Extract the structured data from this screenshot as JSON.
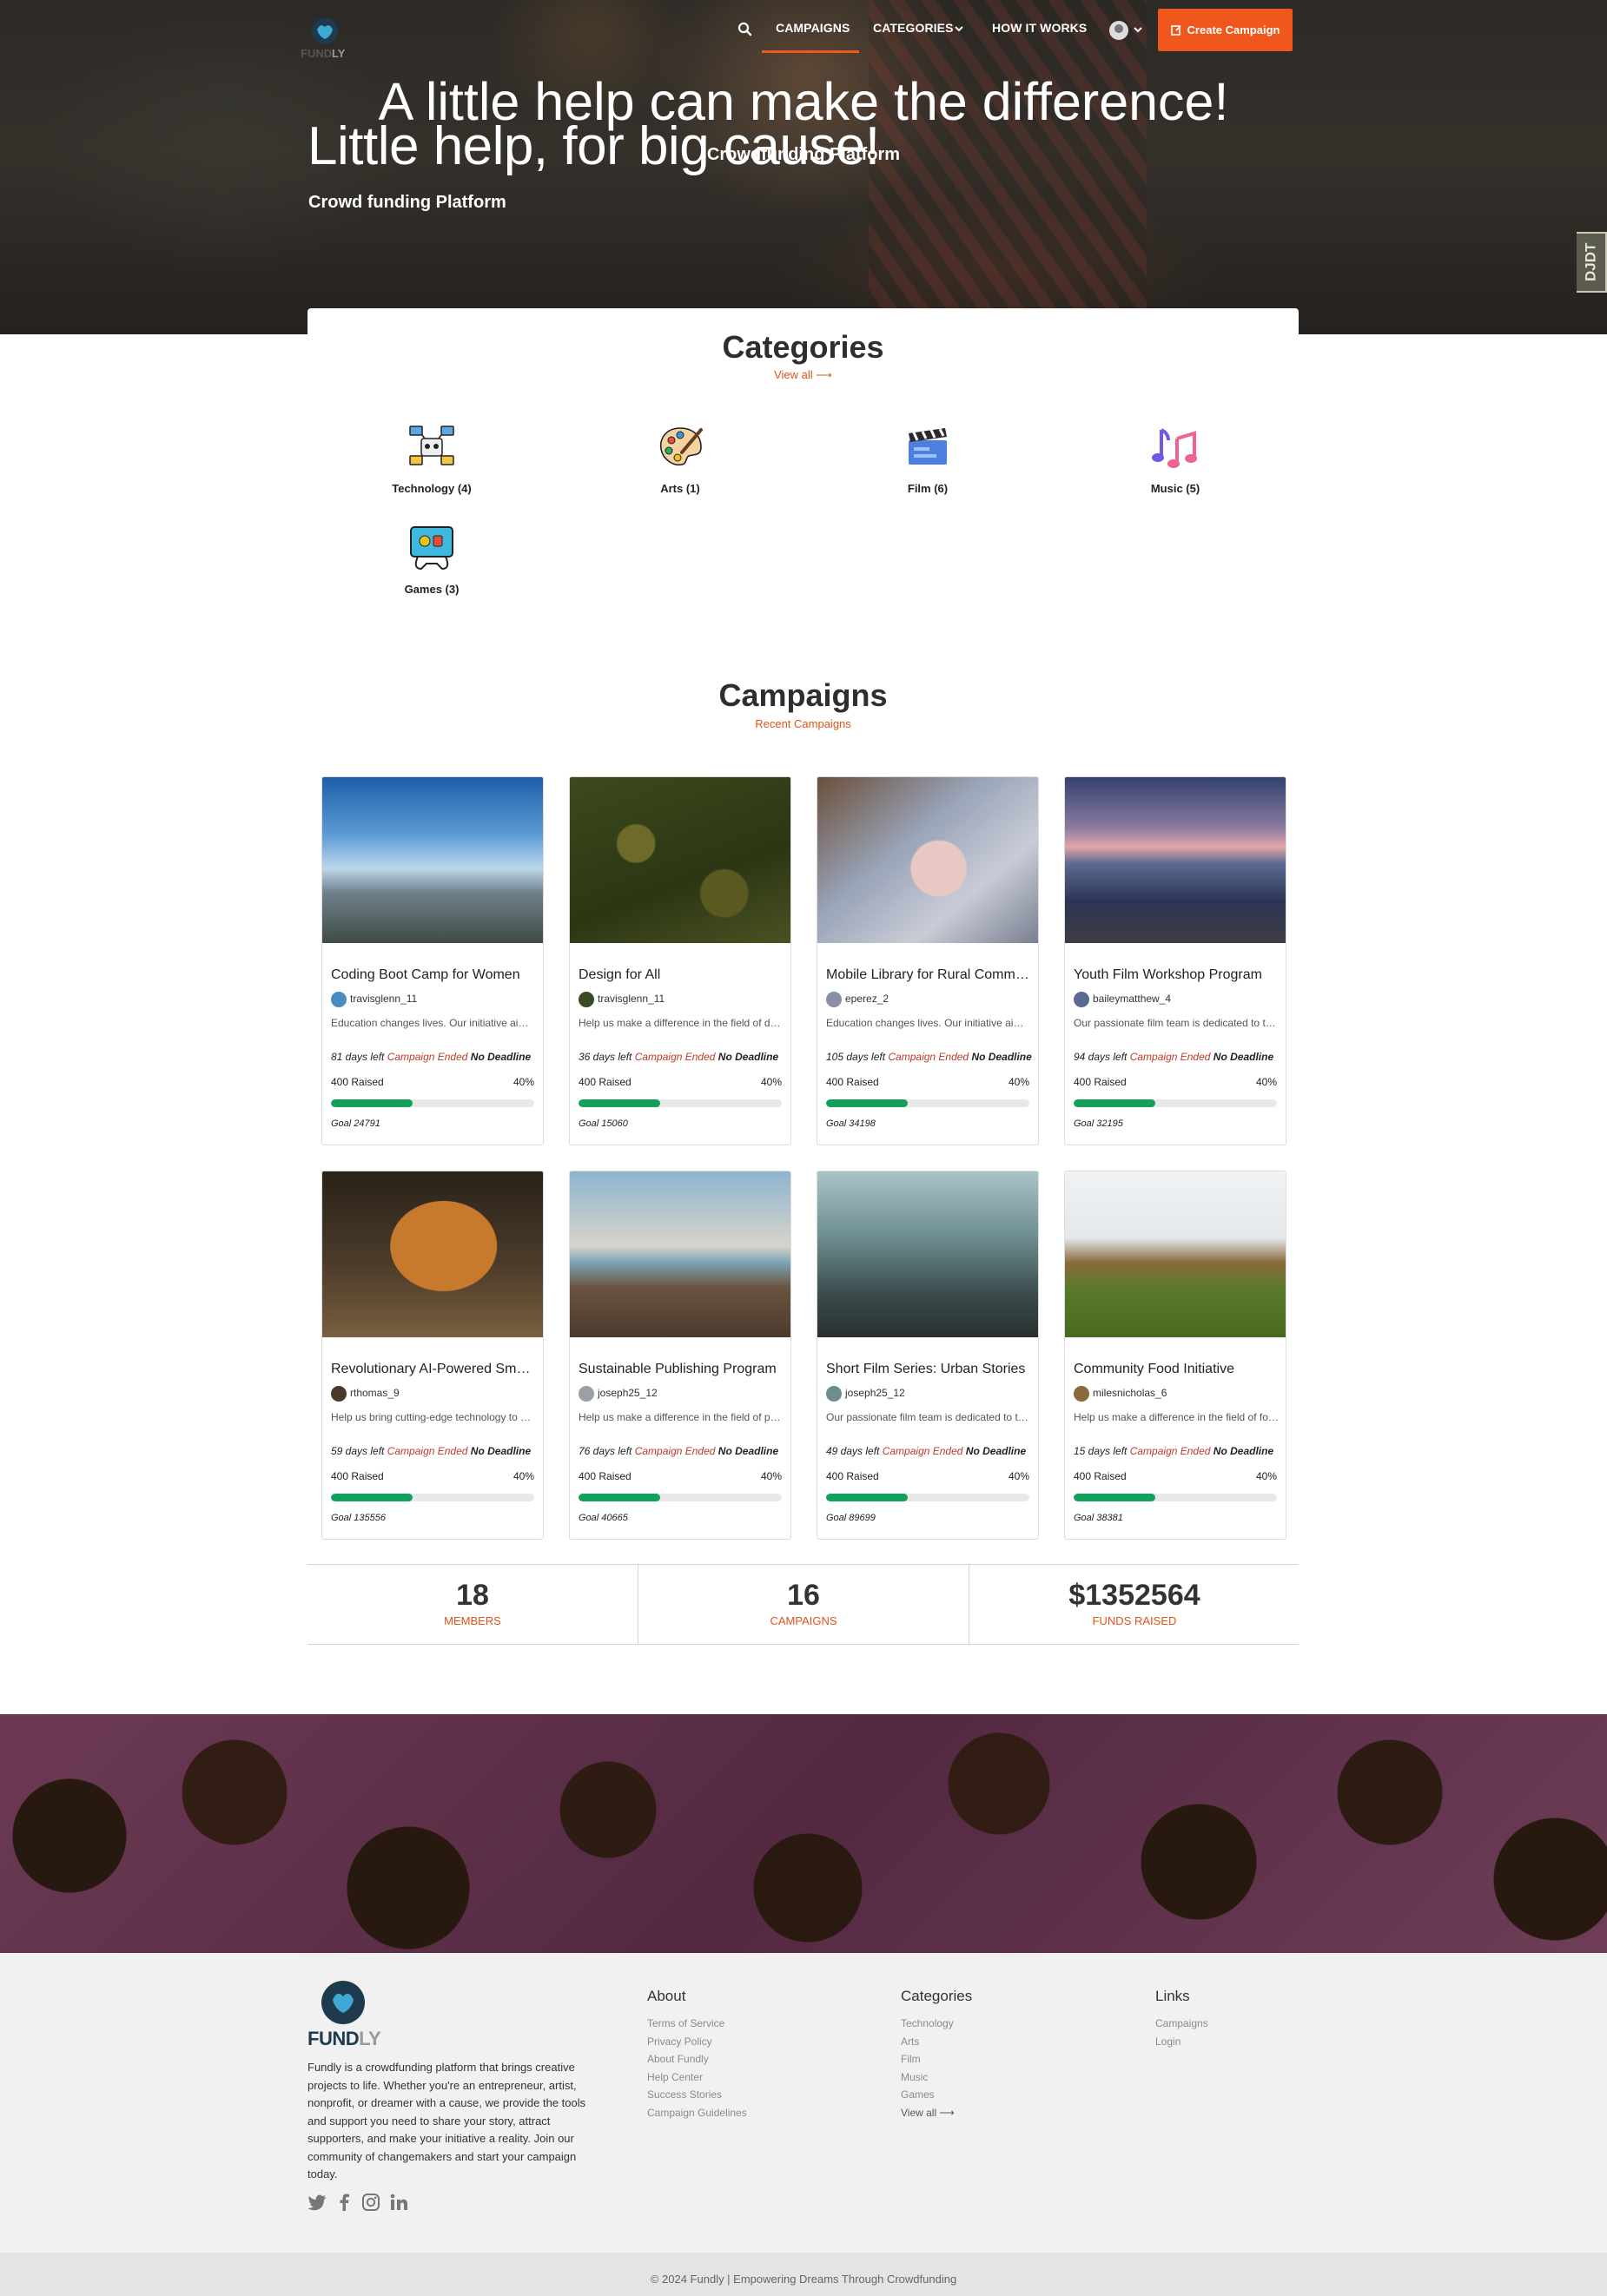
{
  "brand": {
    "name_part1": "FUND",
    "name_part2": "LY"
  },
  "nav": {
    "campaigns": "CAMPAIGNS",
    "categories": "CATEGORIES",
    "how_it_works": "HOW IT WORKS",
    "create": "Create Campaign",
    "side_tab": "DJDT"
  },
  "hero": {
    "title": "Little help, for big cause!",
    "subtitle": "Crowd funding Platform"
  },
  "categories": {
    "title": "Categories",
    "view_all": "View all ⟶",
    "items": [
      {
        "label": "Technology (4)",
        "icon": "technology-icon"
      },
      {
        "label": "Arts (1)",
        "icon": "palette-icon"
      },
      {
        "label": "Film (6)",
        "icon": "clapperboard-icon"
      },
      {
        "label": "Music (5)",
        "icon": "music-notes-icon"
      },
      {
        "label": "Games (3)",
        "icon": "game-console-icon"
      }
    ]
  },
  "campaigns": {
    "title": "Campaigns",
    "subtitle": "Recent Campaigns",
    "ended_label": "Campaign Ended",
    "no_deadline_label": "No Deadline",
    "raised_suffix": "Raised",
    "items": [
      {
        "title": "Coding Boot Camp for Women",
        "user": "travisglenn_11",
        "desc": "Education changes lives. Our initiative aims to provide...",
        "days": "81 days left",
        "raised": "400",
        "percent": "40%",
        "progress": 0.4,
        "goal": "Goal 24791",
        "image": "mountain-valley-image"
      },
      {
        "title": "Design for All",
        "user": "travisglenn_11",
        "desc": "Help us make a difference in the field of design...",
        "days": "36 days left",
        "raised": "400",
        "percent": "40%",
        "progress": 0.4,
        "goal": "Goal 15060",
        "image": "forest-aerial-image"
      },
      {
        "title": "Mobile Library for Rural Communities",
        "user": "eperez_2",
        "desc": "Education changes lives. Our initiative aims to provide...",
        "days": "105 days left",
        "raised": "400",
        "percent": "40%",
        "progress": 0.4,
        "goal": "Goal 34198",
        "image": "baby-image"
      },
      {
        "title": "Youth Film Workshop Program",
        "user": "baileymatthew_4",
        "desc": "Our passionate film team is dedicated to telling...",
        "days": "94 days left",
        "raised": "400",
        "percent": "40%",
        "progress": 0.4,
        "goal": "Goal 32195",
        "image": "lake-sunset-image"
      },
      {
        "title": "Revolutionary AI-Powered Smart Home",
        "user": "rthomas_9",
        "desc": "Help us bring cutting-edge technology to everyday...",
        "days": "59 days left",
        "raised": "400",
        "percent": "40%",
        "progress": 0.4,
        "goal": "Goal 135556",
        "image": "tiger-image"
      },
      {
        "title": "Sustainable Publishing Program",
        "user": "joseph25_12",
        "desc": "Help us make a difference in the field of publishing...",
        "days": "76 days left",
        "raised": "400",
        "percent": "40%",
        "progress": 0.4,
        "goal": "Goal 40665",
        "image": "pier-image"
      },
      {
        "title": "Short Film Series: Urban Stories",
        "user": "joseph25_12",
        "desc": "Our passionate film team is dedicated to telling...",
        "days": "49 days left",
        "raised": "400",
        "percent": "40%",
        "progress": 0.4,
        "goal": "Goal 89699",
        "image": "foggy-railway-image"
      },
      {
        "title": "Community Food Initiative",
        "user": "milesnicholas_6",
        "desc": "Help us make a difference in the field of food...",
        "days": "15 days left",
        "raised": "400",
        "percent": "40%",
        "progress": 0.4,
        "goal": "Goal 38381",
        "image": "boat-house-image"
      }
    ]
  },
  "stats": [
    {
      "value": "18",
      "label": "MEMBERS"
    },
    {
      "value": "16",
      "label": "CAMPAIGNS"
    },
    {
      "value": "$1352564",
      "label": "FUNDS RAISED"
    }
  ],
  "banner": {
    "title": "A little help can make the difference!",
    "subtitle": "Crowdfunding Platform"
  },
  "footer": {
    "about_text": "Fundly is a crowdfunding platform that brings creative projects to life. Whether you're an entrepreneur, artist, nonprofit, or dreamer with a cause, we provide the tools and support you need to share your story, attract supporters, and make your initiative a reality. Join our community of changemakers and start your campaign today.",
    "columns": [
      {
        "heading": "About",
        "links": [
          "Terms of Service",
          "Privacy Policy",
          "About Fundly",
          "Help Center",
          "Success Stories",
          "Campaign Guidelines"
        ]
      },
      {
        "heading": "Categories",
        "links": [
          "Technology",
          "Arts",
          "Film",
          "Music",
          "Games",
          "View all ⟶"
        ]
      },
      {
        "heading": "Links",
        "links": [
          "Campaigns",
          "Login"
        ]
      }
    ],
    "copyright": "© 2024 Fundly | Empowering Dreams Through Crowdfunding"
  },
  "colors": {
    "accent": "#f0571d",
    "progress": "#12a05a",
    "ended": "#c0392b"
  }
}
